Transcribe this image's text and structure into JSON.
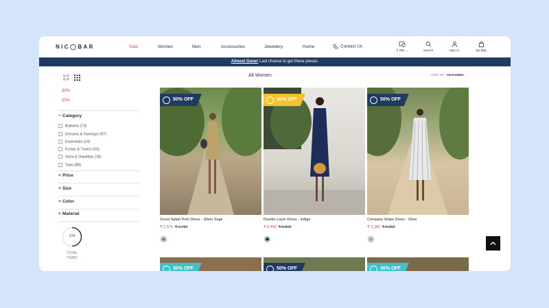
{
  "brand": {
    "logo": "NIC◯BAR"
  },
  "nav": [
    {
      "label": "Sale"
    },
    {
      "label": "Women"
    },
    {
      "label": "Men"
    },
    {
      "label": "Accessories"
    },
    {
      "label": "Jewellery"
    },
    {
      "label": "Home"
    },
    {
      "label": "Contact Us"
    }
  ],
  "utility": {
    "currency": "₹ INR",
    "search": "Search",
    "signin": "Sign In",
    "bag": "My Bag"
  },
  "banner": {
    "link": "Almost Gone!",
    "text": "Last chance to get these pieces."
  },
  "listing": {
    "title": "All Women",
    "sort_prefix": "SORT BY :",
    "sort_value": "FEATURED"
  },
  "sidebar": {
    "price_filters": [
      "30%",
      "20%"
    ],
    "category": {
      "label": "Category",
      "items": [
        "Bottoms (73)",
        "Dresses & Overlays (97)",
        "Essentials (10)",
        "Kurtas & Tunics (53)",
        "Saris & Dupattas (18)",
        "Tops (89)"
      ]
    },
    "filters": [
      "Price",
      "Size",
      "Color",
      "Material"
    ],
    "total": {
      "count": "334",
      "label_line1": "TOTAL",
      "label_line2": "ITEMS"
    }
  },
  "products": [
    {
      "name": "Scout Safari Print Dress - Silver Sage",
      "price": "₹ 2,375",
      "original": "₹ 4,750",
      "discount": "50% OFF",
      "badge_color": "#1f3b62",
      "swatch": "#8a7a55"
    },
    {
      "name": "Double Layer Dress - Indigo",
      "price": "₹ 4,440",
      "original": "₹ 5,800",
      "discount": "30% OFF",
      "badge_color": "#f2c230",
      "swatch": "#1d2a4a"
    },
    {
      "name": "Compass Stripe Dress - Olive",
      "price": "₹ 3,185",
      "original": "₹ 5,250",
      "discount": "50% OFF",
      "badge_color": "#1f3b62",
      "swatch": "#9aa0a8"
    },
    {
      "discount": "30% OFF",
      "badge_color": "#3fc1c9"
    },
    {
      "discount": "50% OFF",
      "badge_color": "#1f3b62"
    },
    {
      "discount": "30% OFF",
      "badge_color": "#3fc1c9"
    }
  ]
}
